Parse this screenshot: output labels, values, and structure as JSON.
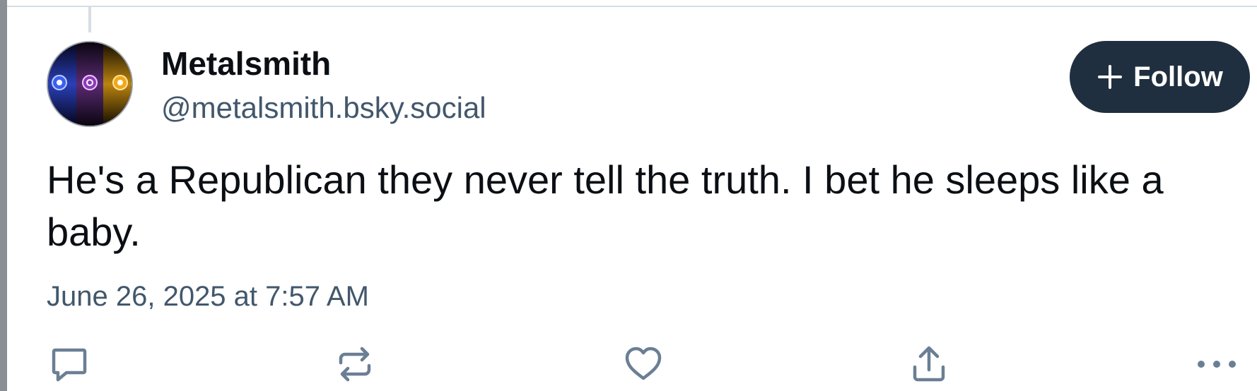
{
  "post": {
    "author": {
      "display_name": "Metalsmith",
      "handle": "@metalsmith.bsky.social",
      "avatar_icon": "avatar-image"
    },
    "follow_button": {
      "label": "Follow",
      "icon": "plus-icon"
    },
    "text": "He's a Republican they never tell the truth. I bet he sleeps like a baby.",
    "timestamp": "June 26, 2025 at 7:57 AM",
    "actions": [
      {
        "name": "reply",
        "icon": "comment-icon"
      },
      {
        "name": "repost",
        "icon": "repost-icon"
      },
      {
        "name": "like",
        "icon": "heart-icon"
      },
      {
        "name": "share",
        "icon": "share-icon"
      },
      {
        "name": "more",
        "icon": "ellipsis-icon"
      }
    ]
  },
  "colors": {
    "text_primary": "#0b0f14",
    "text_secondary": "#42576c",
    "button_bg": "#1f2f3f",
    "icon_color": "#6a7f94",
    "border": "#d6dde4"
  }
}
